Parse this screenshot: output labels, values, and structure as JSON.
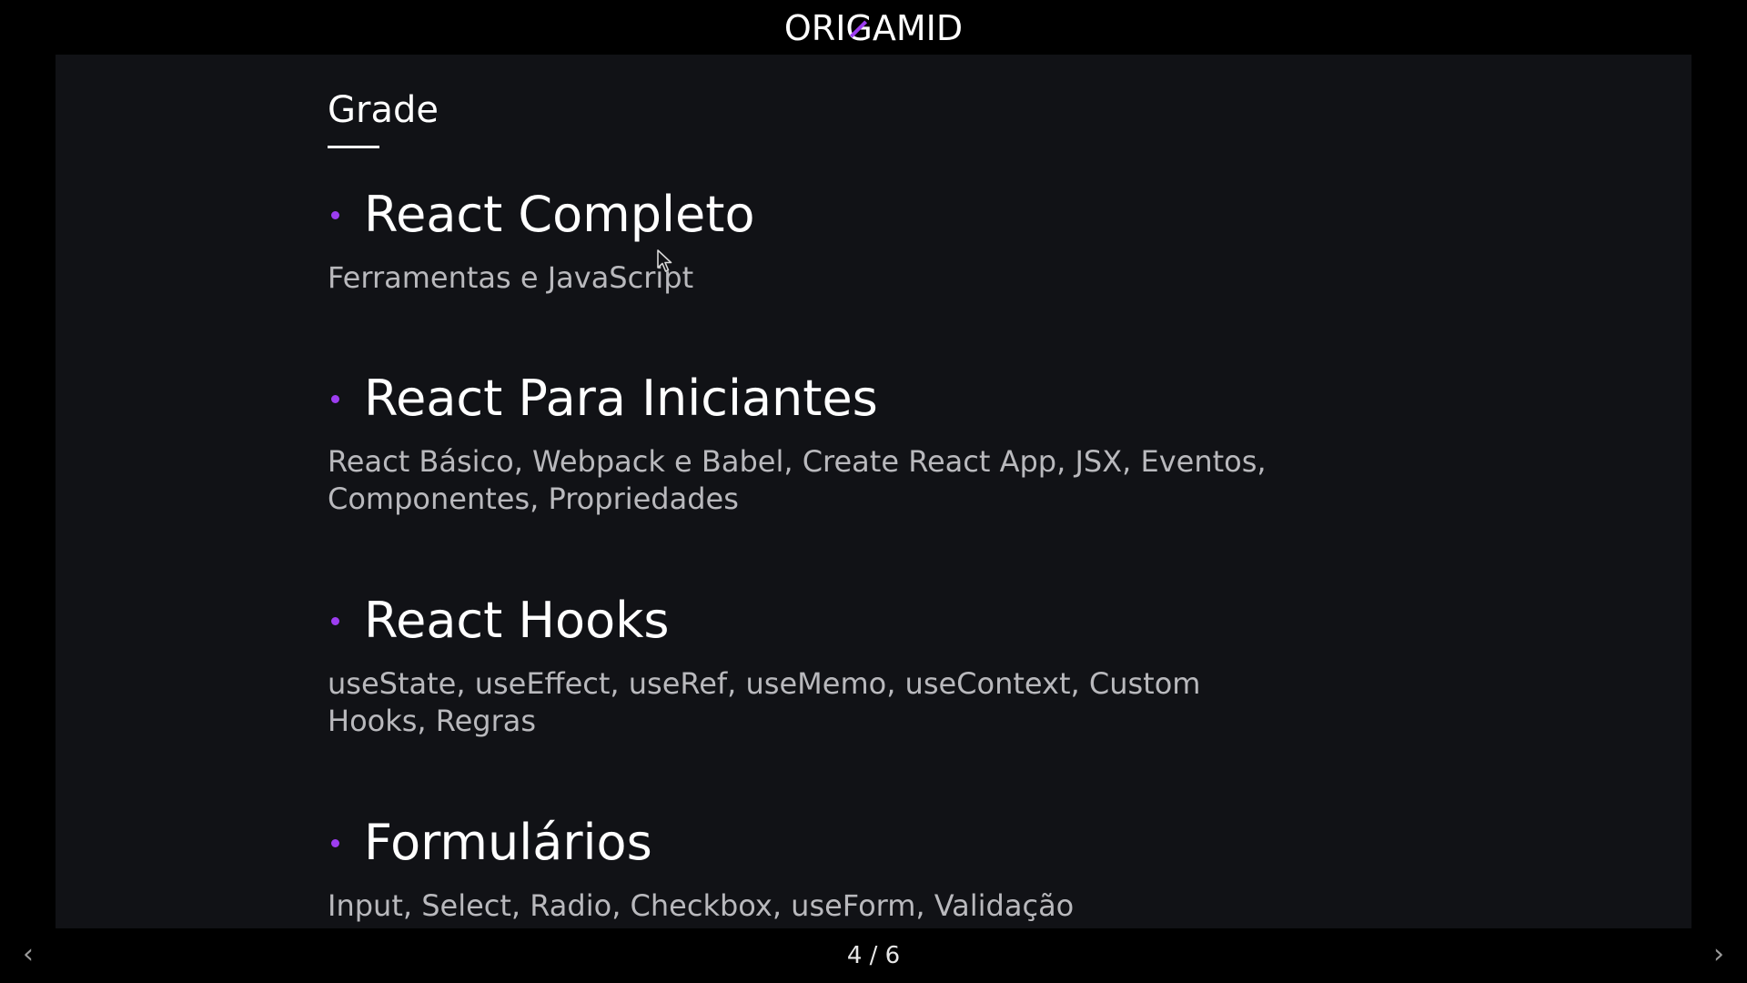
{
  "header": {
    "logo_before": "ORI",
    "logo_mark": "G",
    "logo_after": "AMID"
  },
  "slide": {
    "section_title": "Grade",
    "topics": [
      {
        "title": "React Completo",
        "description": "Ferramentas e JavaScript"
      },
      {
        "title": "React Para Iniciantes",
        "description": "React Básico, Webpack e Babel, Create React App, JSX, Eventos, Componentes, Propriedades"
      },
      {
        "title": "React Hooks",
        "description": "useState, useEffect, useRef, useMemo, useContext, Custom Hooks, Regras"
      },
      {
        "title": "Formulários",
        "description": "Input, Select, Radio, Checkbox, useForm, Validação"
      }
    ]
  },
  "footer": {
    "prev_icon": "chevron-left-icon",
    "next_icon": "chevron-right-icon",
    "prev_label": "‹",
    "next_label": "›",
    "page_indicator": "4 / 6"
  },
  "colors": {
    "background": "#000000",
    "slide_background": "#111216",
    "accent": "#9d3df0",
    "heading_text": "#ffffff",
    "body_text": "#b9b9bd"
  }
}
